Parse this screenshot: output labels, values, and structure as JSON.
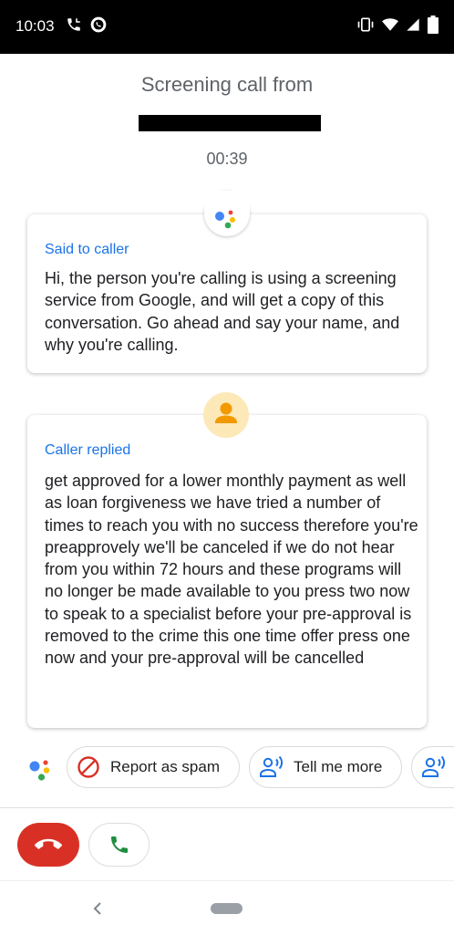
{
  "status_bar": {
    "time": "10:03",
    "icons_left": [
      "phone-call-icon",
      "whatsapp-icon"
    ],
    "icons_right": [
      "vibrate-icon",
      "wifi-icon",
      "signal-icon",
      "battery-icon"
    ]
  },
  "header": {
    "title": "Screening call from",
    "timer": "00:39"
  },
  "transcript": [
    {
      "label": "Said to caller",
      "text": "Hi, the person you're calling is using a screening service from Google, and will get a copy of this conversation. Go ahead and say your name, and why you're calling."
    },
    {
      "label": "Caller replied",
      "text": "get approved for a lower monthly payment as well as loan forgiveness we have tried a number of times to reach you with no success therefore you're preapprovely we'll be canceled if we do not hear from you within 72 hours and these programs will no longer be made available to you press two now to speak to a specialist before your pre-approval is removed to the crime this one time offer press one now and your pre-approval will be cancelled"
    }
  ],
  "actions": {
    "report_spam": "Report as spam",
    "tell_me_more": "Tell me more"
  },
  "colors": {
    "accent": "#1a73e8",
    "end_call": "#d93025",
    "answer_call": "#1e8e3e",
    "avatar_bg": "#fde8b8",
    "avatar_fg": "#f29900"
  }
}
